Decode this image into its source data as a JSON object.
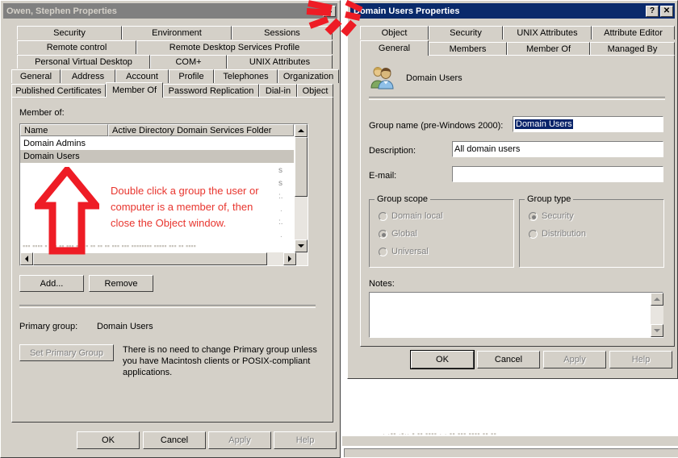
{
  "left_window": {
    "title": "Owen, Stephen Properties",
    "active": false,
    "close_button": "✕",
    "tab_rows": [
      [
        "Security",
        "Environment",
        "Sessions"
      ],
      [
        "Remote control",
        "Remote Desktop Services Profile"
      ],
      [
        "Personal Virtual Desktop",
        "COM+",
        "UNIX Attributes"
      ],
      [
        "General",
        "Address",
        "Account",
        "Profile",
        "Telephones",
        "Organization"
      ],
      [
        "Published Certificates",
        "Member Of",
        "Password Replication",
        "Dial-in",
        "Object"
      ]
    ],
    "selected_tab": "Member Of",
    "member_of_label": "Member of:",
    "list_columns": [
      "Name",
      "Active Directory Domain Services Folder"
    ],
    "list_rows": [
      {
        "name": "Domain Admins",
        "folder": "",
        "selected": false
      },
      {
        "name": "Domain Users",
        "folder": "",
        "selected": true
      }
    ],
    "add_button": "Add...",
    "remove_button": "Remove",
    "primary_group_label": "Primary group:",
    "primary_group_value": "Domain Users",
    "set_primary_group_button": "Set Primary Group",
    "primary_group_note": "There is no need to change Primary group unless\nyou have Macintosh clients or POSIX-compliant\napplications.",
    "buttons": [
      {
        "label": "OK",
        "enabled": true
      },
      {
        "label": "Cancel",
        "enabled": true
      },
      {
        "label": "Apply",
        "enabled": false
      },
      {
        "label": "Help",
        "enabled": false
      }
    ]
  },
  "right_window": {
    "title": "Domain Users Properties",
    "active": true,
    "help_button": "?",
    "close_button": "✕",
    "tab_rows": [
      [
        "Object",
        "Security",
        "UNIX Attributes",
        "Attribute Editor"
      ],
      [
        "General",
        "Members",
        "Member Of",
        "Managed By"
      ]
    ],
    "selected_tab": "General",
    "header_name": "Domain Users",
    "header_icon": "group-users-icon",
    "fields": [
      {
        "label": "Group name (pre-Windows 2000):",
        "value": "Domain Users",
        "selected": true
      },
      {
        "label": "Description:",
        "value": "All domain users",
        "selected": false
      },
      {
        "label": "E-mail:",
        "value": "",
        "selected": false
      }
    ],
    "group_scope": {
      "title": "Group scope",
      "options": [
        {
          "label": "Domain local",
          "checked": false
        },
        {
          "label": "Global",
          "checked": true
        },
        {
          "label": "Universal",
          "checked": false
        }
      ],
      "disabled": true
    },
    "group_type": {
      "title": "Group type",
      "options": [
        {
          "label": "Security",
          "checked": true
        },
        {
          "label": "Distribution",
          "checked": false
        }
      ],
      "disabled": true
    },
    "notes_label": "Notes:",
    "notes_value": "",
    "buttons": [
      {
        "label": "OK",
        "enabled": true,
        "default": true
      },
      {
        "label": "Cancel",
        "enabled": true,
        "default": false
      },
      {
        "label": "Apply",
        "enabled": false,
        "default": false
      },
      {
        "label": "Help",
        "enabled": false,
        "default": false
      }
    ]
  },
  "annotations": {
    "instruction_text": "Double click a group the user or\ncomputer is a member of, then\nclose the Object window.",
    "instruction_color": "#e8352e",
    "arrow_up_color": "#ee1c25",
    "close_arrow_color": "#ee1c25"
  }
}
